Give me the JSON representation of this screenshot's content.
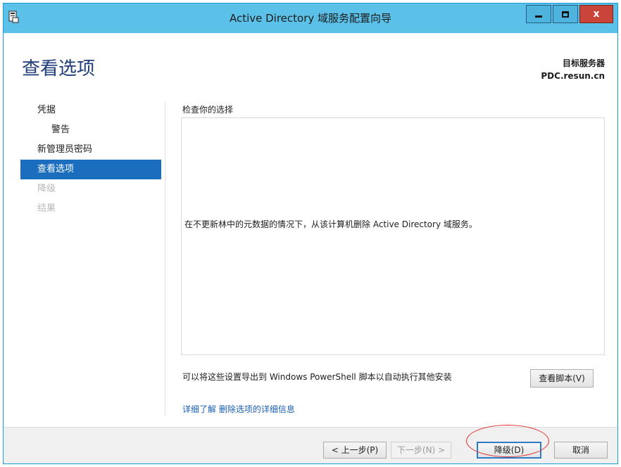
{
  "window": {
    "title": "Active Directory 域服务配置向导",
    "buttons": {
      "minimize": "minimize",
      "maximize": "maximize",
      "close": "x"
    }
  },
  "header": {
    "page_title": "查看选项",
    "target_label": "目标服务器",
    "target_value": "PDC.resun.cn"
  },
  "nav": {
    "items": [
      {
        "label": "凭据",
        "state": "normal",
        "level": 0
      },
      {
        "label": "警告",
        "state": "normal",
        "level": 1
      },
      {
        "label": "新管理员密码",
        "state": "normal",
        "level": 0
      },
      {
        "label": "查看选项",
        "state": "active",
        "level": 0
      },
      {
        "label": "降级",
        "state": "disabled",
        "level": 0
      },
      {
        "label": "结果",
        "state": "disabled",
        "level": 0
      }
    ]
  },
  "main": {
    "section_label": "检查你的选择",
    "review_text": "在不更新林中的元数据的情况下，从该计算机删除 Active Directory 域服务。",
    "export_text": "可以将这些设置导出到 Windows PowerShell 脚本以自动执行其他安装",
    "view_script_label": "查看脚本(V)",
    "more_link": "详细了解 删除选项的详细信息"
  },
  "footer": {
    "prev_label": "< 上一步(P)",
    "next_label": "下一步(N) >",
    "demote_label": "降级(D)",
    "cancel_label": "取消"
  },
  "colors": {
    "titlebar": "#5bc1e8",
    "accent": "#1a6ebd",
    "page_title": "#1f3d7a",
    "link": "#1a5fb4",
    "annotation": "#e03030",
    "close_button": "#c9453a"
  },
  "icons": {
    "app": "server-wizard-icon"
  }
}
